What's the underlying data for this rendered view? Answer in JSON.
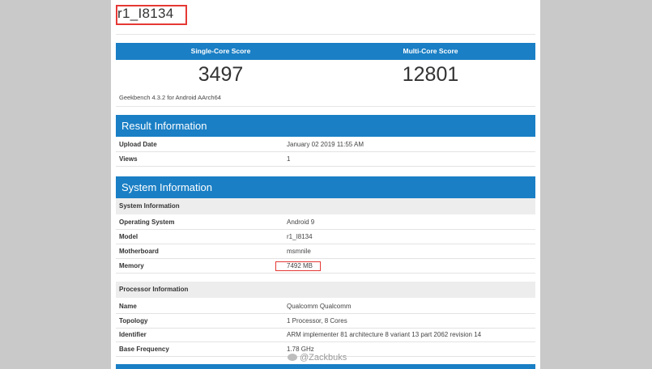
{
  "page_title": "r1_I8134",
  "scores": {
    "single_core_label": "Single-Core Score",
    "multi_core_label": "Multi-Core Score",
    "single_core_value": "3497",
    "multi_core_value": "12801"
  },
  "benchmark_version": "Geekbench 4.3.2 for Android AArch64",
  "result_info": {
    "heading": "Result Information",
    "rows": [
      {
        "key": "Upload Date",
        "value": "January 02 2019 11:55 AM"
      },
      {
        "key": "Views",
        "value": "1"
      }
    ]
  },
  "system_info": {
    "heading": "System Information",
    "sub_system": "System Information",
    "system_rows": [
      {
        "key": "Operating System",
        "value": "Android 9"
      },
      {
        "key": "Model",
        "value": "r1_I8134"
      },
      {
        "key": "Motherboard",
        "value": "msmnile"
      },
      {
        "key": "Memory",
        "value": "7492 MB"
      }
    ],
    "sub_processor": "Processor Information",
    "processor_rows": [
      {
        "key": "Name",
        "value": "Qualcomm Qualcomm"
      },
      {
        "key": "Topology",
        "value": "1 Processor, 8 Cores"
      },
      {
        "key": "Identifier",
        "value": "ARM implementer 81 architecture 8 variant 13 part 2062 revision 14"
      },
      {
        "key": "Base Frequency",
        "value": "1.78 GHz"
      }
    ]
  },
  "watermark": "@Zackbuks",
  "colors": {
    "accent": "#1a7fc5",
    "highlight": "#e53935"
  }
}
